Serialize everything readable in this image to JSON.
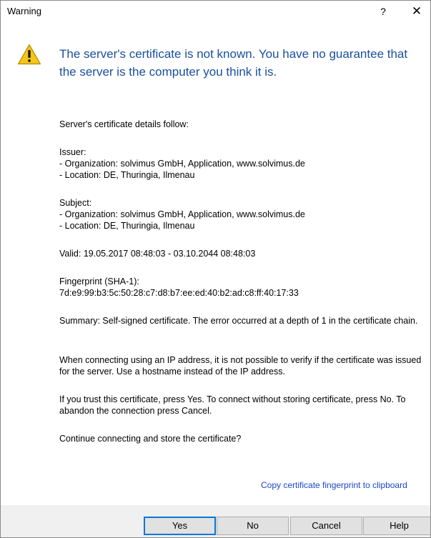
{
  "window": {
    "title": "Warning",
    "help_glyph": "?",
    "close_glyph": "✕"
  },
  "icon": {
    "name": "warning-icon",
    "color": "#f5c518"
  },
  "headline": "The server's certificate is not known. You have no guarantee that the server is the computer you think it is.",
  "details": {
    "intro": "Server's certificate details follow:",
    "issuer_label": "Issuer:",
    "issuer_org": "- Organization: solvimus GmbH, Application, www.solvimus.de",
    "issuer_loc": "- Location: DE, Thuringia, Ilmenau",
    "subject_label": "Subject:",
    "subject_org": "- Organization: solvimus GmbH, Application, www.solvimus.de",
    "subject_loc": "- Location: DE, Thuringia, Ilmenau",
    "valid": "Valid: 19.05.2017 08:48:03 - 03.10.2044 08:48:03",
    "fingerprint_label": "Fingerprint (SHA-1):",
    "fingerprint_value": "7d:e9:99:b3:5c:50:28:c7:d8:b7:ee:ed:40:b2:ad:c8:ff:40:17:33",
    "summary": "Summary: Self-signed certificate. The error occurred at a depth of 1 in the certificate chain.",
    "ip_note": "When connecting using an IP address, it is not possible to verify if the certificate was issued for the server. Use a hostname instead of the IP address.",
    "trust_note": "If you trust this certificate, press Yes. To connect without storing certificate, press No. To abandon the connection press Cancel.",
    "question": "Continue connecting and store the certificate?"
  },
  "link": "Copy certificate fingerprint to clipboard",
  "buttons": {
    "yes": "Yes",
    "no": "No",
    "cancel": "Cancel",
    "help": "Help"
  },
  "colors": {
    "headline": "#1a4fa0",
    "link": "#1a46c8",
    "accent": "#0078d7",
    "footer": "#f0f0f0"
  }
}
